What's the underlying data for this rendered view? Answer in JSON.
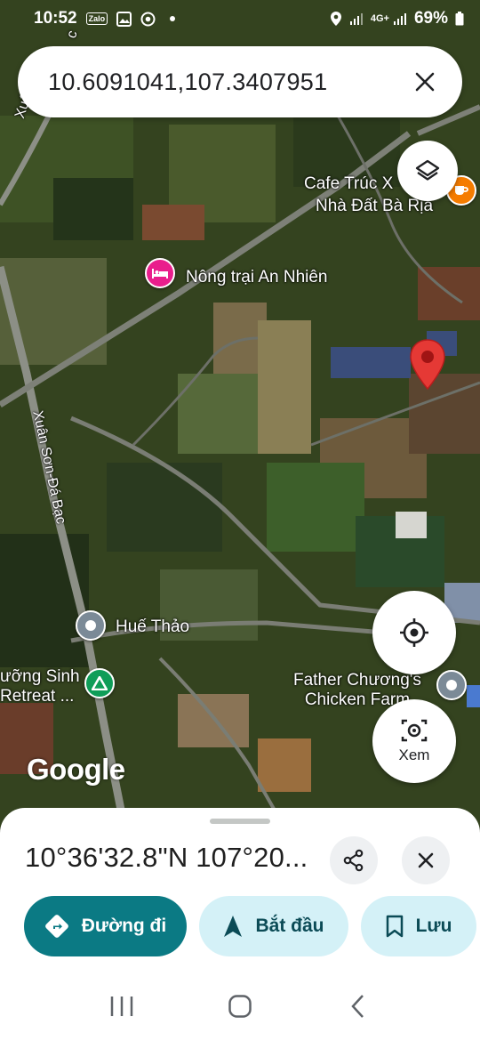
{
  "status_bar": {
    "time": "10:52",
    "notif_zalo": "Zalo",
    "network": "4G+",
    "battery": "69%"
  },
  "search": {
    "query": "10.6091041,107.3407951"
  },
  "map": {
    "labels": {
      "cafe_line1": "Cafe Trúc X",
      "cafe_line2": "Nhà Đất Bà Rịa",
      "hotel": "Nông trại An Nhiên",
      "place_hue_thao": "Huế Thảo",
      "retreat_line1": "ưỡng Sinh",
      "retreat_line2": "Retreat ...",
      "chicken_line1": "Father Chương's",
      "chicken_line2": "Chicken Farm",
      "road_top": "Xuân Sơn",
      "road_top_tail": "c",
      "road_main": "Xuân Sơn-Đá Bạc"
    },
    "google_logo": "Google",
    "pin_color": "#e53935",
    "hotel_pin_color": "#e91e8c",
    "cafe_pin_color": "#f57c00",
    "park_pin_color": "#0f9d58",
    "generic_pin_color": "#7b8a97"
  },
  "controls": {
    "layers_icon": "layers-icon",
    "locate_icon": "my-location-icon",
    "streetview_label": "Xem"
  },
  "sheet": {
    "title": "10°36'32.8\"N 107°20...",
    "directions_label": "Đường đi",
    "start_label": "Bắt đầu",
    "save_label": "Lưu",
    "accent": "#0b7a84",
    "chip_bg": "#d4f1f7"
  }
}
